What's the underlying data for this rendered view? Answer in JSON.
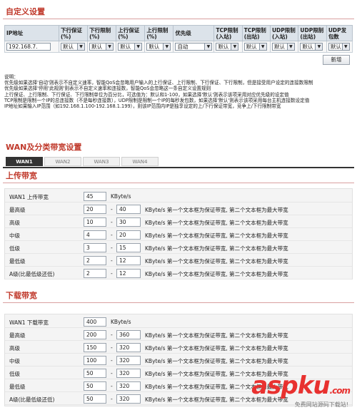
{
  "custom": {
    "title": "自定义设置",
    "headers": [
      "IP地址",
      "下行保证(%)",
      "下行限制(%)",
      "上行保证(%)",
      "上行限制(%)",
      "优先级",
      "TCP限制(入站)",
      "TCP限制(出站)",
      "UDP限制(入站)",
      "UDP限制(出站)",
      "UDP发包数"
    ],
    "row": {
      "ip": "192.168.7.",
      "defaults": [
        "默认",
        "默认",
        "默认",
        "默认"
      ],
      "priority": "自动",
      "limits": [
        "默认",
        "默认",
        "默认",
        "默认",
        "默认"
      ]
    },
    "add_button": "新增"
  },
  "notes": [
    "说明：",
    "优先级如果选择'自动'则表示不自定义速率，智能QoS会忽略用户输入的上行保证、上行限制、下行保证、下行限制，但是接受用户设定的连接数限制",
    "优先级如果选择'停用'此规则'则表示不自定义速率和连接数，智能QoS会忽略这一条自定义设置规则",
    "上行保证、上行限制、下行保证、下行限制单位为百分比，可选值为：默认和1-100，如果选择'默认'则表示该项采用对应优先级的设定值",
    "TCP限制是限制一个IP的总连接数（不是每秒连接数），UDP限制是限制一个IP的每秒发包数，如果选择'默认'则表示该项采用每台主机连接数设定值",
    "IP地址如果输入IP范围（如192.168.1.100-192.168.1.199），则该IP范围内IP是独享设定的上/下行保证带宽，竞争上/下行限制带宽"
  ],
  "wan": {
    "title": "WAN及分类带宽设置",
    "tabs": [
      "WAN1",
      "WAN2",
      "WAN3",
      "WAN4"
    ]
  },
  "upload": {
    "title": "上传带宽",
    "total_label": "WAN1 上传带宽",
    "total_value": "45",
    "unit": "KByte/s",
    "desc": "KByte/s 第一个文本框为保证带宽, 第二个文本框为最大带宽",
    "rows": [
      {
        "label": "最高级",
        "min": "20",
        "max": "40"
      },
      {
        "label": "高级",
        "min": "10",
        "max": "30"
      },
      {
        "label": "中级",
        "min": "4",
        "max": "20"
      },
      {
        "label": "低级",
        "min": "3",
        "max": "15"
      },
      {
        "label": "最低级",
        "min": "2",
        "max": "12"
      },
      {
        "label": "A级(比最低级还低)",
        "min": "2",
        "max": "12"
      }
    ]
  },
  "download": {
    "title": "下载带宽",
    "total_label": "WAN1 下载带宽",
    "total_value": "400",
    "unit": "KByte/s",
    "desc": "KByte/s 第一个文本框为保证带宽, 第二个文本框为最大带宽",
    "rows": [
      {
        "label": "最高级",
        "min": "200",
        "max": "360"
      },
      {
        "label": "高级",
        "min": "150",
        "max": "320"
      },
      {
        "label": "中级",
        "min": "100",
        "max": "320"
      },
      {
        "label": "低级",
        "min": "50",
        "max": "320"
      },
      {
        "label": "最低级",
        "min": "50",
        "max": "320"
      },
      {
        "label": "A级(比最低级还低)",
        "min": "50",
        "max": "320"
      }
    ]
  },
  "watermark": {
    "logo": "aspku",
    "tld": ".com",
    "sub": "免费网站源码下载站!"
  }
}
